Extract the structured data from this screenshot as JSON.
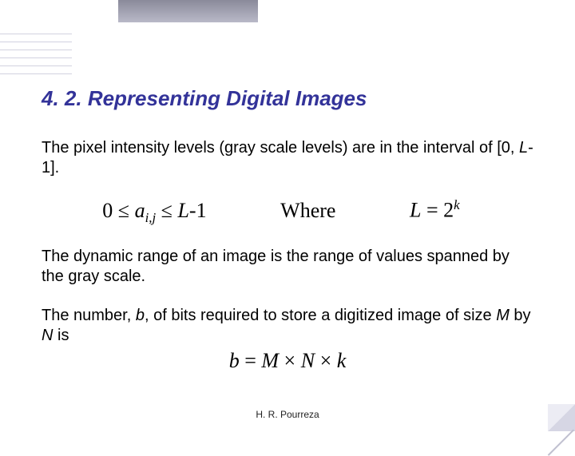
{
  "title": "4. 2. Representing Digital Images",
  "para1_a": "The pixel intensity levels (gray scale levels) are in the interval of [0, ",
  "para1_L": "L",
  "para1_b": "-1].",
  "eq": {
    "zero": "0 ",
    "le1": "≤",
    "a": " a",
    "ij": "i,j",
    "le2": " ≤ ",
    "L": "L",
    "minus1": "-1",
    "where": "Where",
    "L2": "L",
    "eq2": " = 2",
    "k": "k"
  },
  "para2": "The dynamic range of an image is the range of values spanned by the gray scale.",
  "para3_a": "The number, ",
  "para3_b": "b",
  "para3_c": ", of bits required to store a digitized image of size ",
  "para3_M": "M",
  "para3_by": " by ",
  "para3_N": "N",
  "para3_is": " is",
  "eq2line": {
    "b": "b",
    "eq": " = ",
    "M": "M",
    "x1": " × ",
    "N": "N",
    "x2": " × ",
    "k": "k"
  },
  "footer": "H. R. Pourreza"
}
